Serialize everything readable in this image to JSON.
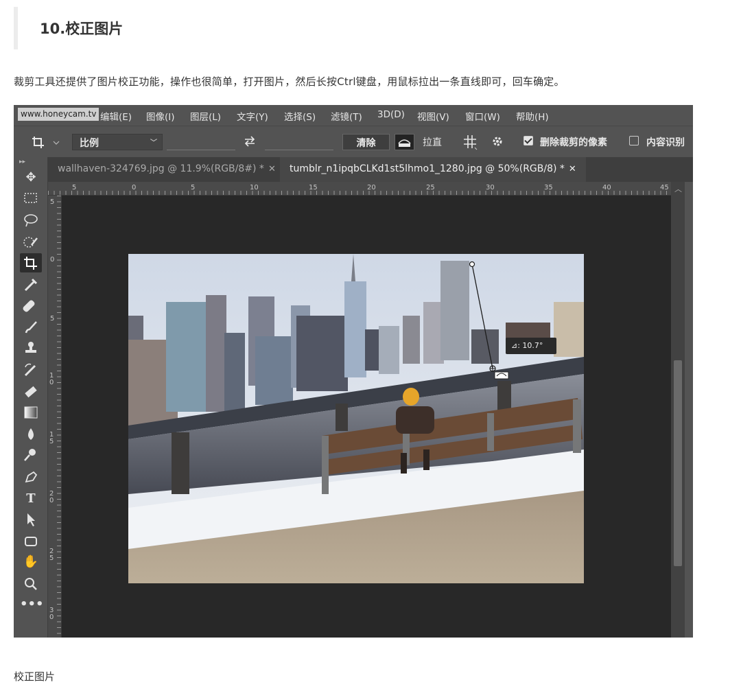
{
  "article": {
    "heading": "10.校正图片",
    "paragraph": "裁剪工具还提供了图片校正功能，操作也很简单，打开图片，然后长按Ctrl键盘，用鼠标拉出一条直线即可，回车确定。",
    "caption": "校正图片"
  },
  "watermark": "www.honeycam.tv",
  "menu": [
    "编辑(E)",
    "图像(I)",
    "图层(L)",
    "文字(Y)",
    "选择(S)",
    "滤镜(T)",
    "3D(D)",
    "视图(V)",
    "窗口(W)",
    "帮助(H)"
  ],
  "options": {
    "ratio": "比例",
    "clear": "清除",
    "straighten": "拉直",
    "delete_cropped": "删除裁剪的像素",
    "delete_cropped_checked": true,
    "content_aware": "内容识别",
    "content_aware_checked": false
  },
  "tabs": [
    {
      "label": "wallhaven-324769.jpg @ 11.9%(RGB/8#) *",
      "active": false
    },
    {
      "label": "tumblr_n1ipqbCLKd1st5lhmo1_1280.jpg @ 50%(RGB/8) *",
      "active": true
    }
  ],
  "ruler_top_labels": [
    "5",
    "0",
    "5",
    "10",
    "15",
    "20",
    "25",
    "30",
    "35",
    "40",
    "45"
  ],
  "ruler_left_labels": [
    "5",
    "0",
    "5",
    "10",
    "15",
    "20",
    "25",
    "30"
  ],
  "straighten_angle": "⊿: 10.7°",
  "tools": [
    "move-icon",
    "marquee-icon",
    "lasso-icon",
    "quick-select-icon",
    "crop-icon",
    "eyedropper-icon",
    "healing-icon",
    "brush-icon",
    "stamp-icon",
    "history-brush-icon",
    "eraser-icon",
    "gradient-icon",
    "blur-icon",
    "dodge-icon",
    "pen-icon",
    "type-icon",
    "path-select-icon",
    "shape-icon",
    "hand-icon",
    "zoom-icon",
    "more-icon"
  ]
}
